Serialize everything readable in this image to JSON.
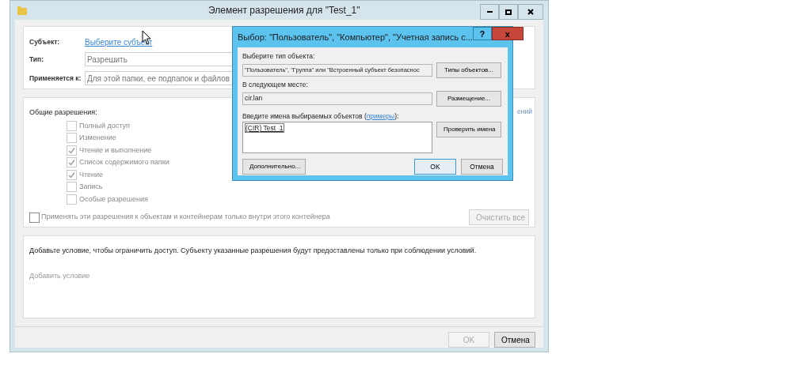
{
  "window": {
    "title": "Элемент разрешения для \"Test_1\""
  },
  "principal": {
    "label": "Субъект:",
    "link": "Выберите субъект"
  },
  "fields": [
    {
      "label": "Тип:",
      "value": "Разрешить"
    },
    {
      "label": "Применяется к:",
      "value": "Для этой папки, ее подпапок и файлов"
    }
  ],
  "permissions": {
    "heading": "Общие разрешения:",
    "side_link": "ений",
    "items": [
      {
        "label": "Полный доступ",
        "checked": false
      },
      {
        "label": "Изменение",
        "checked": false
      },
      {
        "label": "Чтение и выполнение",
        "checked": true
      },
      {
        "label": "Список содержимого папки",
        "checked": true
      },
      {
        "label": "Чтение",
        "checked": true
      },
      {
        "label": "Запись",
        "checked": false
      },
      {
        "label": "Особые разрешения",
        "checked": false
      }
    ],
    "apply_inside": {
      "label": "Применять эти разрешения к объектам и контейнерам только внутри этого контейнера",
      "checked": false
    },
    "clear_button": "Очистить все"
  },
  "condition": {
    "text": "Добавьте условие, чтобы ограничить доступ. Субъекту указанные разрешения будут предоставлены только при соблюдении условий.",
    "link": "Добавить условие"
  },
  "buttons": [
    {
      "label": "OK",
      "disabled": true
    },
    {
      "label": "Отмена",
      "disabled": false
    }
  ],
  "dialog": {
    "title": "Выбор: \"Пользователь\", \"Компьютер\", \"Учетная запись с...",
    "help": "?",
    "close": "x",
    "object_type_label": "Выберите тип объекта:",
    "object_type_value": "\"Пользователь\", \"Группа\" или \"Встроенный субъект безопаснос",
    "object_types_button": "Типы объектов...",
    "location_label": "В следующем месте:",
    "location_value": "cir.lan",
    "location_button": "Размещение...",
    "names_label_before": "Введите имена выбираемых объектов (",
    "names_link": "примеры",
    "names_label_after": "):",
    "names_value": "(CIR) Test_1",
    "check_button": "Проверить имена",
    "advanced_button": "Дополнительно...",
    "ok_button": "OK",
    "cancel_button": "Отмена"
  }
}
